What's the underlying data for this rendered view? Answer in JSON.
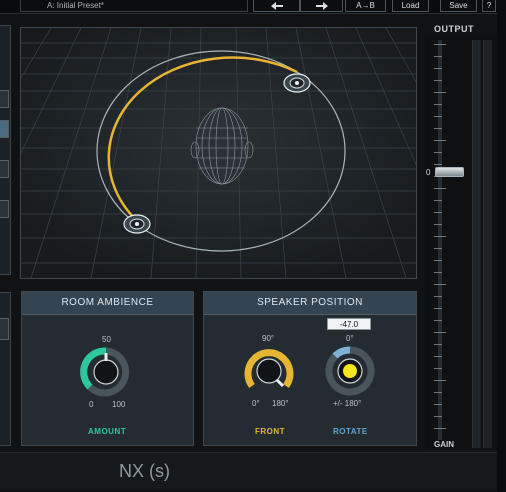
{
  "toolbar": {
    "preset": "A: Initial Preset*",
    "undo_icon": "arrow-left-icon",
    "redo_icon": "arrow-right-icon",
    "ab_label": "A→B",
    "load_label": "Load",
    "save_label": "Save",
    "help_label": "?"
  },
  "room_ambience": {
    "title": "ROOM AMBIENCE",
    "value_top": "50",
    "min": "0",
    "max": "100",
    "footer": "AMOUNT",
    "amount": 0.5
  },
  "speaker_position": {
    "title": "SPEAKER POSITION",
    "rotate_value": "-47.0",
    "front_top": "90°",
    "front_min": "0°",
    "front_max": "180°",
    "rotate_top": "0°",
    "rotate_range": "+/- 180°",
    "front_label": "FRONT",
    "rotate_label": "ROTATE"
  },
  "output": {
    "title": "OUTPUT",
    "zero_label": "0",
    "gain_label": "GAIN"
  },
  "plugin_title": "NX (s)",
  "colors": {
    "accent_yellow": "#e7b534",
    "accent_teal": "#2fc7a0",
    "rotate_yellow": "#f4e618"
  }
}
